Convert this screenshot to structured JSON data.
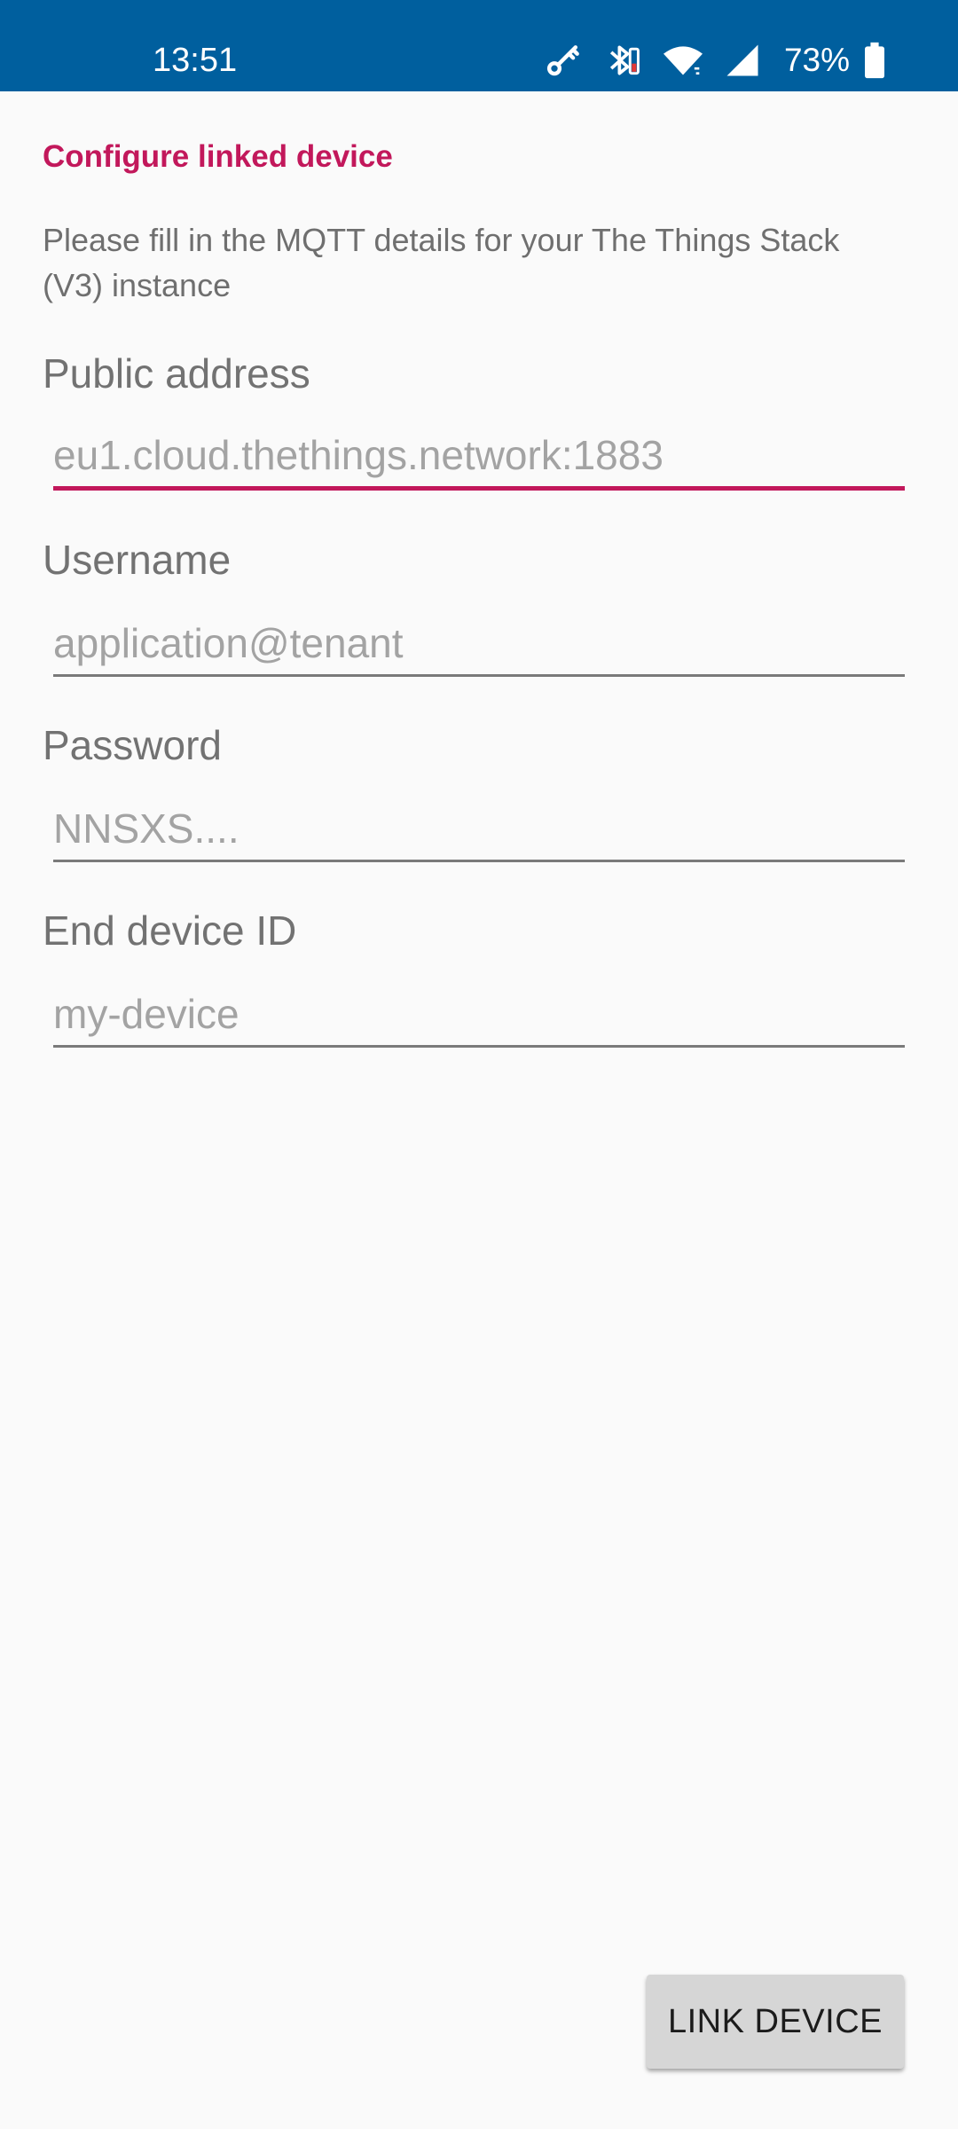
{
  "status_bar": {
    "time": "13:51",
    "battery_percent": "73%",
    "icons": [
      "vpn-key-icon",
      "bluetooth-icon",
      "wifi-icon",
      "cell-signal-icon",
      "battery-icon"
    ]
  },
  "page": {
    "title": "Configure linked device",
    "description": "Please fill in the MQTT details for your The Things Stack (V3) instance"
  },
  "form": {
    "public_address": {
      "label": "Public address",
      "placeholder": "eu1.cloud.thethings.network:1883",
      "value": ""
    },
    "username": {
      "label": "Username",
      "placeholder": "application@tenant",
      "value": ""
    },
    "password": {
      "label": "Password",
      "placeholder": "NNSXS....",
      "value": ""
    },
    "end_device_id": {
      "label": "End device ID",
      "placeholder": "my-device",
      "value": ""
    }
  },
  "actions": {
    "link_device_label": "LINK DEVICE"
  },
  "colors": {
    "status_bar": "#005f9e",
    "accent": "#c2185b",
    "background": "#fafafa",
    "button": "#d6d6d6"
  }
}
